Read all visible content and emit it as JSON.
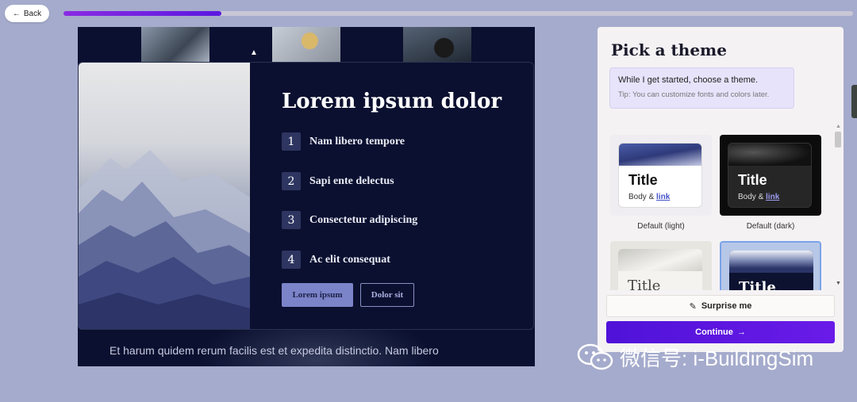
{
  "nav": {
    "back_label": "Back",
    "progress_fraction": 0.2
  },
  "preview": {
    "title": "Lorem ipsum dolor",
    "items": [
      {
        "num": "1",
        "label": "Nam libero tempore"
      },
      {
        "num": "2",
        "label": "Sapi ente delectus"
      },
      {
        "num": "3",
        "label": "Consectetur adipiscing"
      },
      {
        "num": "4",
        "label": "Ac elit consequat"
      }
    ],
    "primary_button": "Lorem ipsum",
    "secondary_button": "Dolor sit",
    "footer_text": "Et harum quidem rerum facilis est et expedita distinctio. Nam libero"
  },
  "panel": {
    "title": "Pick a theme",
    "message": "While I get started, choose a theme.",
    "tip": "Tip: You can customize fonts and colors later.",
    "themes": [
      {
        "name": "Default (light)",
        "title": "Title",
        "body": "Body &",
        "link": "link"
      },
      {
        "name": "Default (dark)",
        "title": "Title",
        "body": "Body &",
        "link": "link"
      },
      {
        "name": "",
        "title": "Title"
      },
      {
        "name": "",
        "title": "Title"
      }
    ],
    "surprise_label": "Surprise me",
    "continue_label": "Continue"
  },
  "watermark": {
    "text": "微信号: i-BuildingSim"
  },
  "colors": {
    "accent": "#5b19e0",
    "slide_bg": "#0b1030",
    "page_bg": "#a5abcc"
  }
}
